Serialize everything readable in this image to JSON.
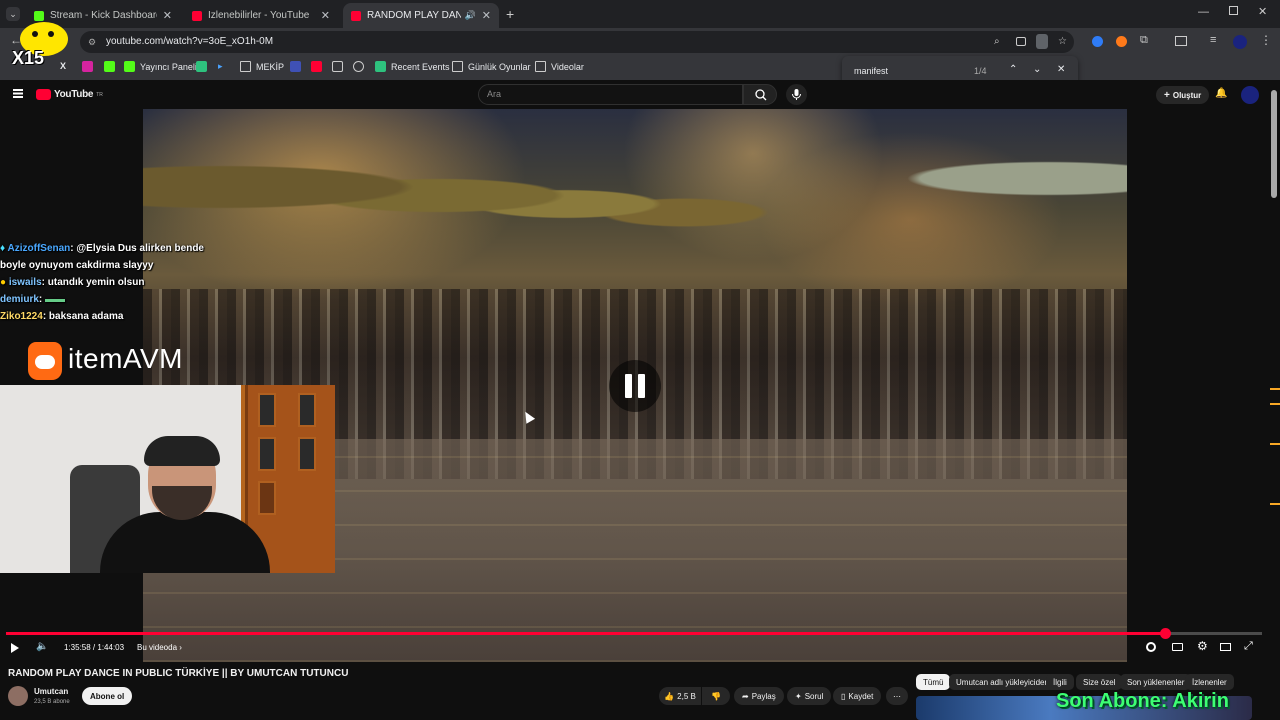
{
  "browser": {
    "tabs": [
      {
        "title": "Stream - Kick Dashboard",
        "favicon_color": "#53fc18",
        "active": false
      },
      {
        "title": "İzlenebilirler - YouTube",
        "favicon_color": "#ff0033",
        "active": false
      },
      {
        "title": "RANDOM PLAY DANCE IN",
        "favicon_color": "#ff0033",
        "active": true
      }
    ],
    "url": "youtube.com/watch?v=3oE_xO1h-0M",
    "bookmarks": [
      "Yayıncı Paneli",
      "MEKİP",
      "Recent Events",
      "Günlük Oyunlar",
      "Videolar"
    ],
    "find": {
      "query": "manifest",
      "count": "1/4"
    }
  },
  "youtube": {
    "logo_text": "YouTube",
    "logo_sup": "TR",
    "search_placeholder": "Ara",
    "create_label": "Oluştur"
  },
  "stream_overlay": {
    "badge_text": "X15",
    "chat": [
      {
        "user": "AzizoffSenan",
        "message": ": @Elysia Dus alirken bende boyle oynuyom cakdirma slayyy"
      },
      {
        "user": "iswails",
        "message": ": utandık yemin olsun"
      },
      {
        "user": "demiurk",
        "message": ":"
      },
      {
        "user": "Ziko1224",
        "message": ": baksana adama"
      }
    ],
    "sponsor_name": "itemAVM",
    "follower_banner": "Son Abone: Akirin"
  },
  "player": {
    "time_current": "1:35:58",
    "time_total": "1:44:03",
    "chapter_label": "Bu videoda",
    "progress_fraction": 0.9225
  },
  "video_info": {
    "title": "RANDOM PLAY DANCE IN PUBLIC TÜRKİYE || BY UMUTCAN TUTUNCU",
    "channel": "Umutcan",
    "subscribers": "23,5 B abone",
    "subscribe_label": "Abone ol",
    "likes": "2,5 B",
    "share_label": "Paylaş",
    "ask_label": "Sorul",
    "save_label": "Kaydet"
  },
  "related_chips": [
    "Tümü",
    "Umutcan adlı yükleyiciden",
    "İlgili",
    "Size özel",
    "Son yüklenenler",
    "İzlenenler"
  ],
  "colors": {
    "accent": "#ff0033",
    "kick": "#53fc18",
    "banner": "#3dff73"
  }
}
